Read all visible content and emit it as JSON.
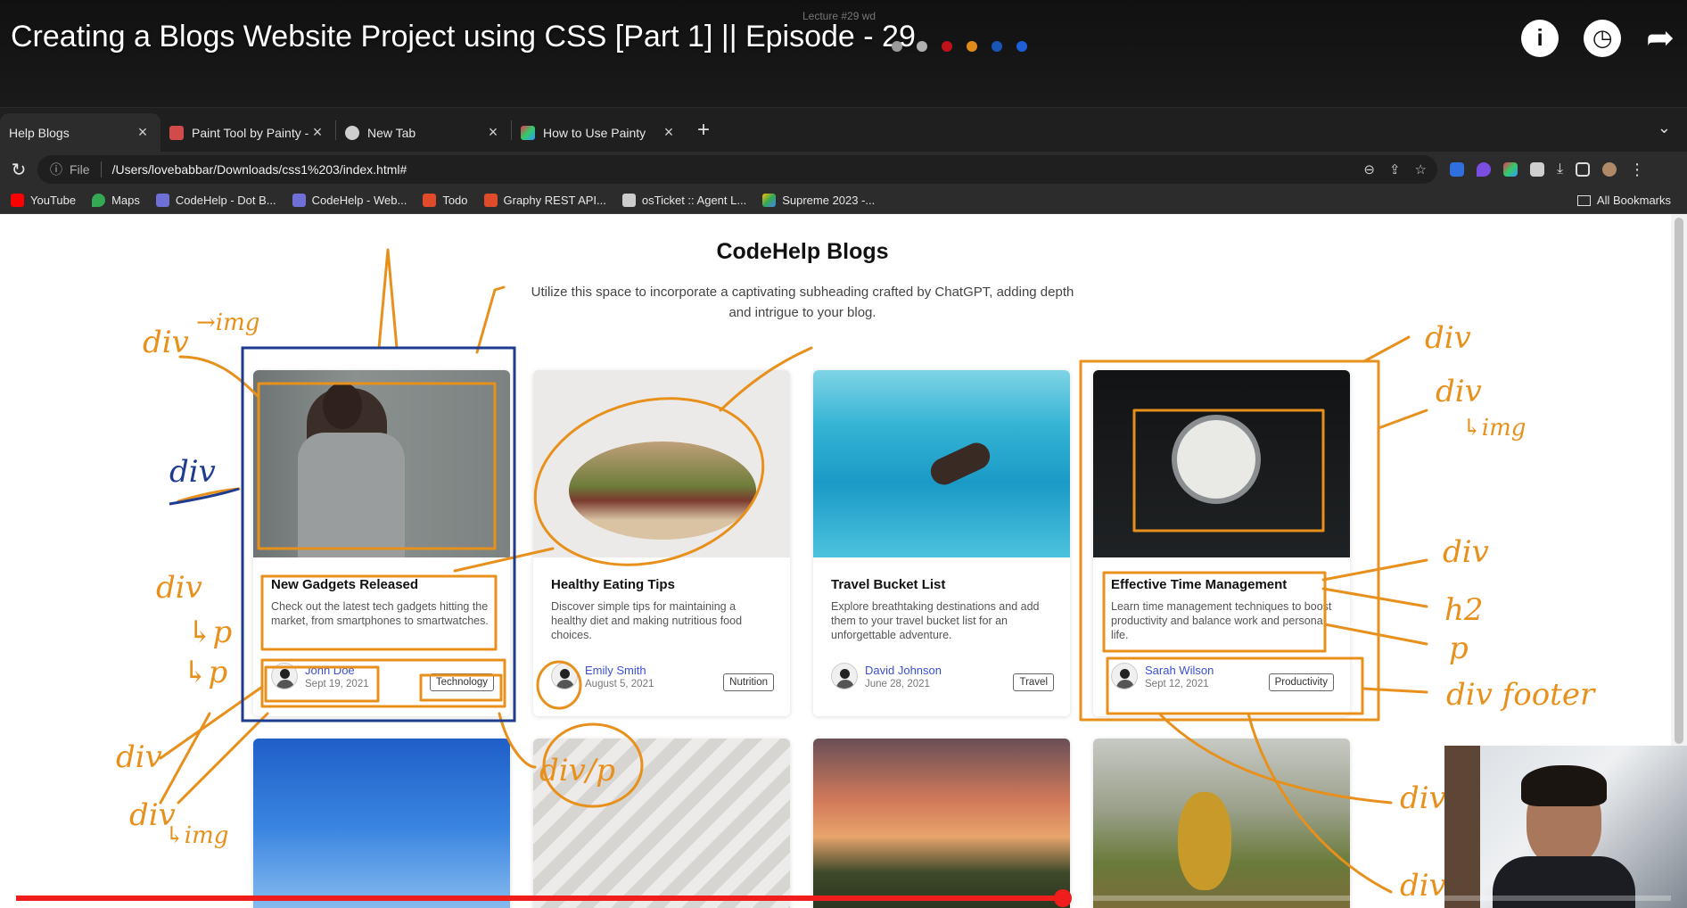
{
  "video": {
    "title": "Creating a Blogs Website Project using CSS [Part 1] || Episode - 29",
    "lecture_label": "Lecture #29 wd",
    "progress_fraction": 0.63,
    "icons": [
      "info-icon",
      "clock-icon",
      "share-icon"
    ],
    "palette_colors": [
      "#9a9a9a",
      "#b0b0b0",
      "#c0121a",
      "#e08a1a",
      "#1a56b8",
      "#1e5fd8"
    ]
  },
  "browser": {
    "tabs": [
      {
        "label": "Help Blogs",
        "active": true,
        "color": "#2c2c2c"
      },
      {
        "label": "Paint Tool by Painty - Chrome",
        "active": false,
        "color": "#d14b4b"
      },
      {
        "label": "New Tab",
        "active": false,
        "color": "#cfcfcf"
      },
      {
        "label": "How to Use Painty",
        "active": false,
        "color": "#e3a232"
      }
    ],
    "address": {
      "scheme_label": "File",
      "url": "/Users/lovebabbar/Downloads/css1%203/index.html#"
    },
    "bookmarks": [
      {
        "label": "YouTube",
        "color": "#ff0000"
      },
      {
        "label": "Maps",
        "color": "#34a853"
      },
      {
        "label": "CodeHelp - Dot B...",
        "color": "#6f6fd8"
      },
      {
        "label": "CodeHelp - Web...",
        "color": "#6f6fd8"
      },
      {
        "label": "Todo",
        "color": "#e04b2c"
      },
      {
        "label": "Graphy REST API...",
        "color": "#e04b2c"
      },
      {
        "label": "osTicket :: Agent L...",
        "color": "#cccccc"
      },
      {
        "label": "Supreme 2023 -...",
        "color": "#34a853"
      }
    ],
    "all_bookmarks": "All Bookmarks"
  },
  "page": {
    "title": "CodeHelp Blogs",
    "subtitle": "Utilize this space to incorporate a captivating subheading crafted by ChatGPT, adding depth and intrigue to your blog.",
    "cards": [
      {
        "title": "New Gadgets Released",
        "desc": "Check out the latest tech gadgets hitting the market, from smartphones to smartwatches.",
        "author": "John Doe",
        "date": "Sept 19, 2021",
        "tag": "Technology"
      },
      {
        "title": "Healthy Eating Tips",
        "desc": "Discover simple tips for maintaining a healthy diet and making nutritious food choices.",
        "author": "Emily Smith",
        "date": "August 5, 2021",
        "tag": "Nutrition"
      },
      {
        "title": "Travel Bucket List",
        "desc": "Explore breathtaking destinations and add them to your travel bucket list for an unforgettable adventure.",
        "author": "David Johnson",
        "date": "June 28, 2021",
        "tag": "Travel"
      },
      {
        "title": "Effective Time Management",
        "desc": "Learn time management techniques to boost productivity and balance work and personal life.",
        "author": "Sarah Wilson",
        "date": "Sept 12, 2021",
        "tag": "Productivity"
      }
    ]
  },
  "annotations": {
    "color": "#e8901c",
    "labels": [
      "div",
      "img",
      "div",
      "img",
      "div",
      "p",
      "p",
      "div",
      "img",
      "div/p",
      "div",
      "div",
      "img",
      "div",
      "h2",
      "p",
      "div footer",
      "div",
      "div"
    ]
  }
}
